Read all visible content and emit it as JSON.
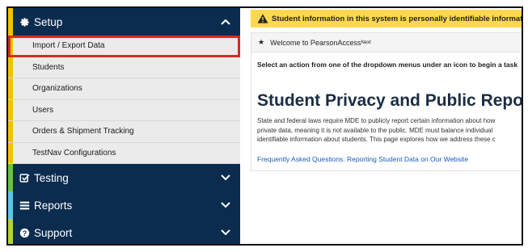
{
  "sidebar": {
    "setup": {
      "label": "Setup",
      "icon": "gear-icon",
      "stripe_color": "#f2c100",
      "expanded": true
    },
    "setup_items": [
      {
        "label": "Import / Export Data",
        "highlighted": true
      },
      {
        "label": "Students"
      },
      {
        "label": "Organizations"
      },
      {
        "label": "Users"
      },
      {
        "label": "Orders & Shipment Tracking"
      },
      {
        "label": "TestNav Configurations"
      }
    ],
    "testing": {
      "label": "Testing",
      "icon": "checkbox-icon",
      "stripe_color": "#6cc04a"
    },
    "reports": {
      "label": "Reports",
      "icon": "list-icon",
      "stripe_color": "#5bc6e8"
    },
    "support": {
      "label": "Support",
      "icon": "question-circle-icon",
      "stripe_color": "#b4d232"
    }
  },
  "main": {
    "alert_text": "Student information in this system is personally identifiable information",
    "welcome": "Welcome to PearsonAccess",
    "welcome_sup": "Next",
    "instruction": "Select an action from one of the dropdown menus under an icon to begin a task",
    "title": "Student Privacy and Public Reports",
    "body_lines": [
      "State and federal laws require MDE to publicly report certain information about how",
      "private data, meaning it is not available to the public. MDE must balance individual",
      "identifiable information about students. This page explores how we address these c"
    ],
    "faq_link": "Frequently Asked Questions: Reporting Student Data on Our Website"
  },
  "colors": {
    "sidebar_bg": "#0b2c4f",
    "alert_bg": "#ffd84d",
    "highlight": "#d62b1f",
    "link": "#1a5bb8"
  }
}
